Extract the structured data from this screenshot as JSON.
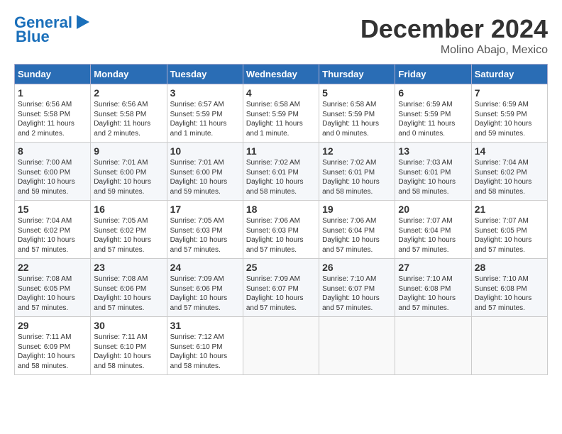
{
  "header": {
    "logo_line1": "General",
    "logo_line2": "Blue",
    "month": "December 2024",
    "location": "Molino Abajo, Mexico"
  },
  "days_of_week": [
    "Sunday",
    "Monday",
    "Tuesday",
    "Wednesday",
    "Thursday",
    "Friday",
    "Saturday"
  ],
  "weeks": [
    [
      {
        "day": 1,
        "text": "Sunrise: 6:56 AM\nSunset: 5:58 PM\nDaylight: 11 hours\nand 2 minutes."
      },
      {
        "day": 2,
        "text": "Sunrise: 6:56 AM\nSunset: 5:58 PM\nDaylight: 11 hours\nand 2 minutes."
      },
      {
        "day": 3,
        "text": "Sunrise: 6:57 AM\nSunset: 5:59 PM\nDaylight: 11 hours\nand 1 minute."
      },
      {
        "day": 4,
        "text": "Sunrise: 6:58 AM\nSunset: 5:59 PM\nDaylight: 11 hours\nand 1 minute."
      },
      {
        "day": 5,
        "text": "Sunrise: 6:58 AM\nSunset: 5:59 PM\nDaylight: 11 hours\nand 0 minutes."
      },
      {
        "day": 6,
        "text": "Sunrise: 6:59 AM\nSunset: 5:59 PM\nDaylight: 11 hours\nand 0 minutes."
      },
      {
        "day": 7,
        "text": "Sunrise: 6:59 AM\nSunset: 5:59 PM\nDaylight: 10 hours\nand 59 minutes."
      }
    ],
    [
      {
        "day": 8,
        "text": "Sunrise: 7:00 AM\nSunset: 6:00 PM\nDaylight: 10 hours\nand 59 minutes."
      },
      {
        "day": 9,
        "text": "Sunrise: 7:01 AM\nSunset: 6:00 PM\nDaylight: 10 hours\nand 59 minutes."
      },
      {
        "day": 10,
        "text": "Sunrise: 7:01 AM\nSunset: 6:00 PM\nDaylight: 10 hours\nand 59 minutes."
      },
      {
        "day": 11,
        "text": "Sunrise: 7:02 AM\nSunset: 6:01 PM\nDaylight: 10 hours\nand 58 minutes."
      },
      {
        "day": 12,
        "text": "Sunrise: 7:02 AM\nSunset: 6:01 PM\nDaylight: 10 hours\nand 58 minutes."
      },
      {
        "day": 13,
        "text": "Sunrise: 7:03 AM\nSunset: 6:01 PM\nDaylight: 10 hours\nand 58 minutes."
      },
      {
        "day": 14,
        "text": "Sunrise: 7:04 AM\nSunset: 6:02 PM\nDaylight: 10 hours\nand 58 minutes."
      }
    ],
    [
      {
        "day": 15,
        "text": "Sunrise: 7:04 AM\nSunset: 6:02 PM\nDaylight: 10 hours\nand 57 minutes."
      },
      {
        "day": 16,
        "text": "Sunrise: 7:05 AM\nSunset: 6:02 PM\nDaylight: 10 hours\nand 57 minutes."
      },
      {
        "day": 17,
        "text": "Sunrise: 7:05 AM\nSunset: 6:03 PM\nDaylight: 10 hours\nand 57 minutes."
      },
      {
        "day": 18,
        "text": "Sunrise: 7:06 AM\nSunset: 6:03 PM\nDaylight: 10 hours\nand 57 minutes."
      },
      {
        "day": 19,
        "text": "Sunrise: 7:06 AM\nSunset: 6:04 PM\nDaylight: 10 hours\nand 57 minutes."
      },
      {
        "day": 20,
        "text": "Sunrise: 7:07 AM\nSunset: 6:04 PM\nDaylight: 10 hours\nand 57 minutes."
      },
      {
        "day": 21,
        "text": "Sunrise: 7:07 AM\nSunset: 6:05 PM\nDaylight: 10 hours\nand 57 minutes."
      }
    ],
    [
      {
        "day": 22,
        "text": "Sunrise: 7:08 AM\nSunset: 6:05 PM\nDaylight: 10 hours\nand 57 minutes."
      },
      {
        "day": 23,
        "text": "Sunrise: 7:08 AM\nSunset: 6:06 PM\nDaylight: 10 hours\nand 57 minutes."
      },
      {
        "day": 24,
        "text": "Sunrise: 7:09 AM\nSunset: 6:06 PM\nDaylight: 10 hours\nand 57 minutes."
      },
      {
        "day": 25,
        "text": "Sunrise: 7:09 AM\nSunset: 6:07 PM\nDaylight: 10 hours\nand 57 minutes."
      },
      {
        "day": 26,
        "text": "Sunrise: 7:10 AM\nSunset: 6:07 PM\nDaylight: 10 hours\nand 57 minutes."
      },
      {
        "day": 27,
        "text": "Sunrise: 7:10 AM\nSunset: 6:08 PM\nDaylight: 10 hours\nand 57 minutes."
      },
      {
        "day": 28,
        "text": "Sunrise: 7:10 AM\nSunset: 6:08 PM\nDaylight: 10 hours\nand 57 minutes."
      }
    ],
    [
      {
        "day": 29,
        "text": "Sunrise: 7:11 AM\nSunset: 6:09 PM\nDaylight: 10 hours\nand 58 minutes."
      },
      {
        "day": 30,
        "text": "Sunrise: 7:11 AM\nSunset: 6:10 PM\nDaylight: 10 hours\nand 58 minutes."
      },
      {
        "day": 31,
        "text": "Sunrise: 7:12 AM\nSunset: 6:10 PM\nDaylight: 10 hours\nand 58 minutes."
      },
      null,
      null,
      null,
      null
    ]
  ]
}
